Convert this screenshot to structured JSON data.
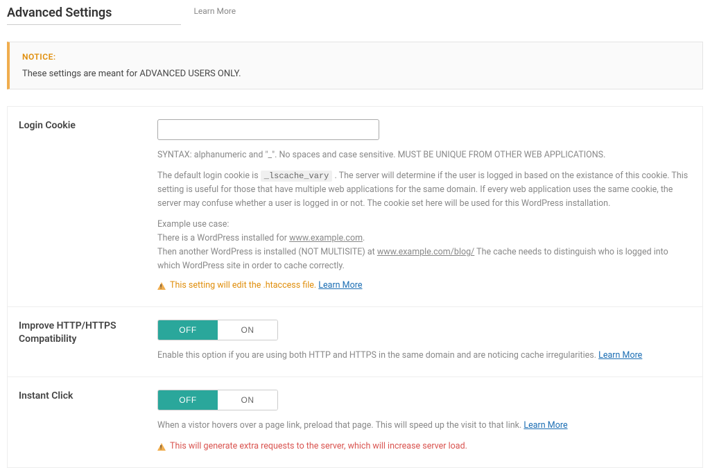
{
  "header": {
    "title": "Advanced Settings",
    "learn_more": "Learn More"
  },
  "notice": {
    "label": "NOTICE:",
    "text": "These settings are meant for ADVANCED USERS ONLY."
  },
  "login_cookie": {
    "label": "Login Cookie",
    "input_value": "",
    "syntax": "SYNTAX: alphanumeric and \"_\". No spaces and case sensitive. MUST BE UNIQUE FROM OTHER WEB APPLICATIONS.",
    "desc_pre": "The default login cookie is ",
    "code": "_lscache_vary",
    "desc_post": " . The server will determine if the user is logged in based on the existance of this cookie. This setting is useful for those that have multiple web applications for the same domain. If every web application uses the same cookie, the server may confuse whether a user is logged in or not. The cookie set here will be used for this WordPress installation.",
    "example_label": "Example use case:",
    "example_line1_pre": "There is a WordPress installed for ",
    "example_link1": "www.example.com",
    "example_line1_post": ".",
    "example_line2_pre": "Then another WordPress is installed (NOT MULTISITE) at ",
    "example_link2": "www.example.com/blog/",
    "example_line2_post": " The cache needs to distinguish who is logged into which WordPress site in order to cache correctly.",
    "warn": "This setting will edit the .htaccess file.",
    "learn_more": "Learn More"
  },
  "http_compat": {
    "label": "Improve HTTP/HTTPS Compatibility",
    "off": "OFF",
    "on": "ON",
    "desc": "Enable this option if you are using both HTTP and HTTPS in the same domain and are noticing cache irregularities. ",
    "learn_more": "Learn More"
  },
  "instant_click": {
    "label": "Instant Click",
    "off": "OFF",
    "on": "ON",
    "desc": "When a vistor hovers over a page link, preload that page. This will speed up the visit to that link. ",
    "learn_more": "Learn More",
    "warn": "This will generate extra requests to the server, which will increase server load."
  }
}
